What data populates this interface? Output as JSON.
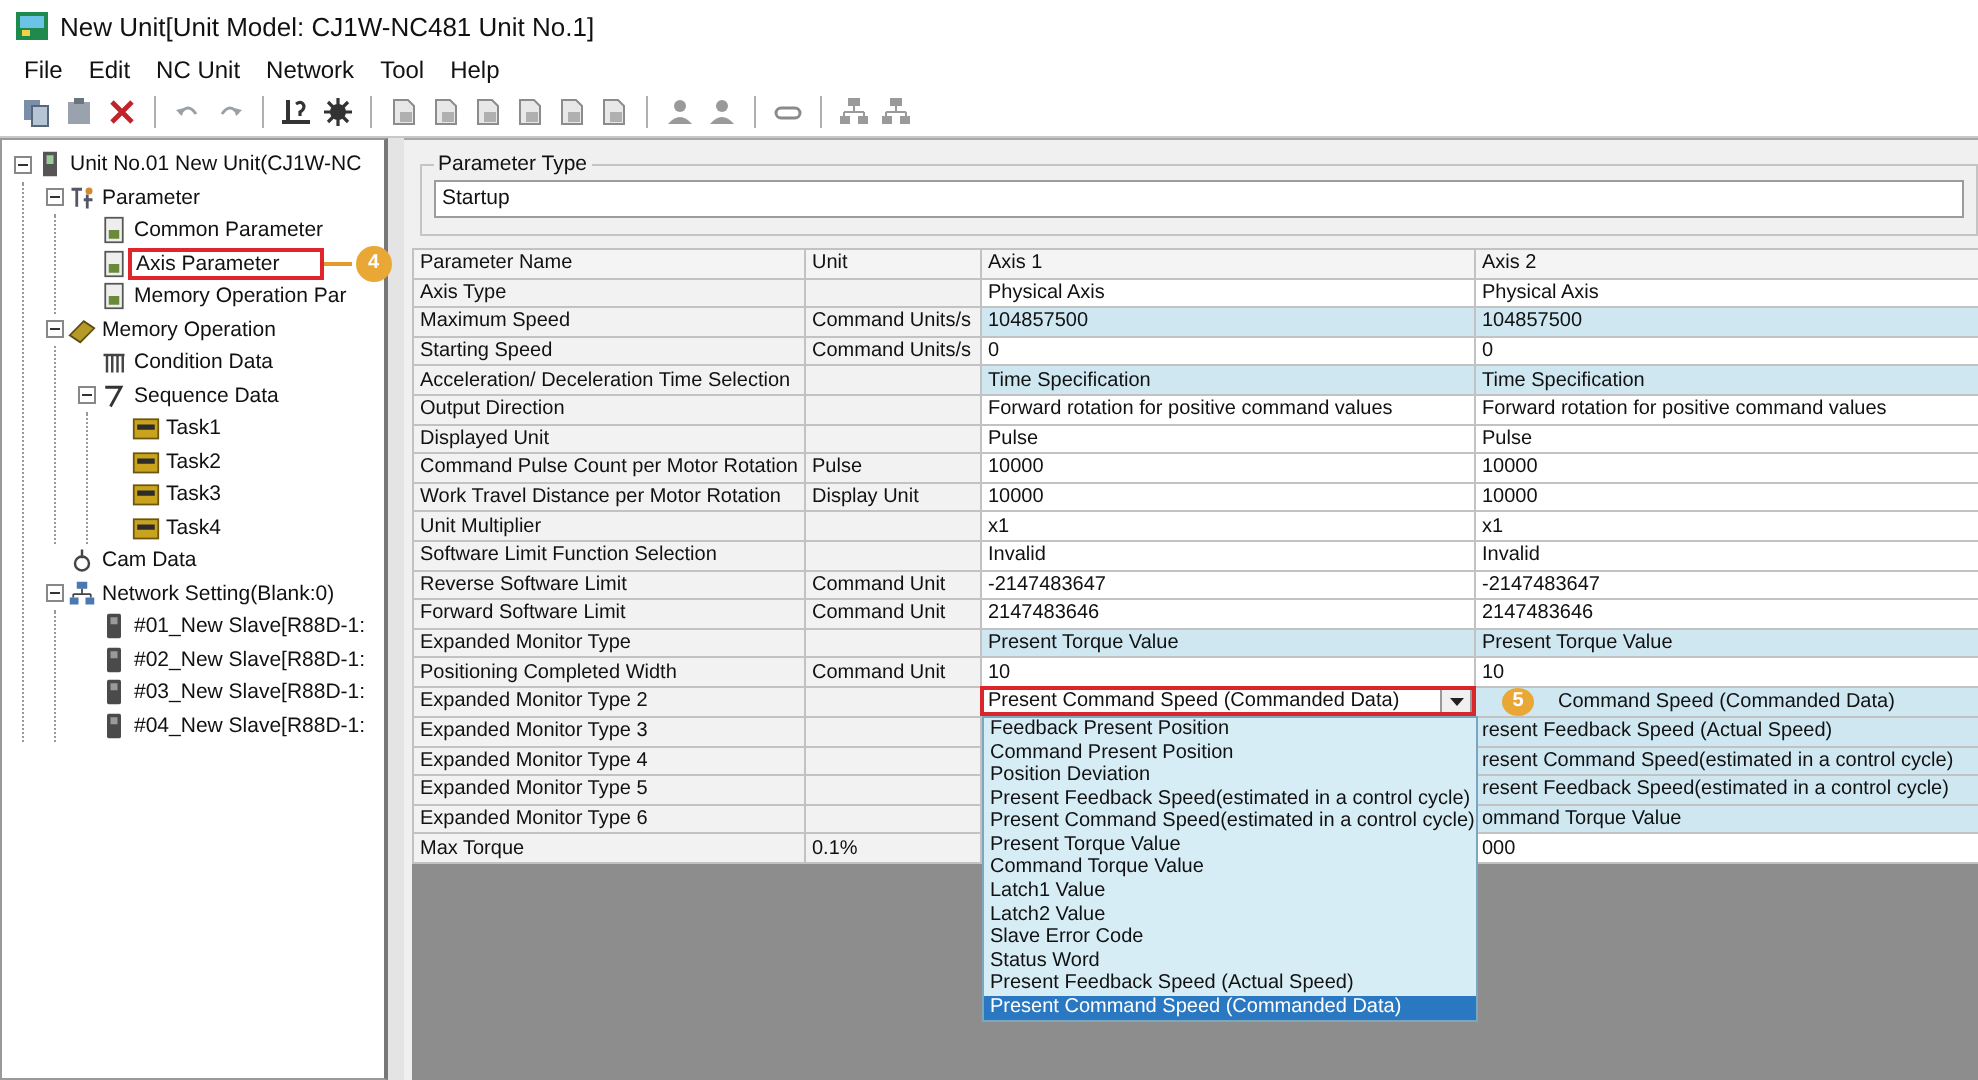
{
  "window": {
    "title": "New Unit[Unit Model: CJ1W-NC481 Unit No.1]"
  },
  "menu": [
    "File",
    "Edit",
    "NC Unit",
    "Network",
    "Tool",
    "Help"
  ],
  "toolbar": [
    {
      "kind": "copy"
    },
    {
      "kind": "clipboard"
    },
    {
      "kind": "delete"
    },
    {
      "kind": "sep"
    },
    {
      "kind": "undo"
    },
    {
      "kind": "redo"
    },
    {
      "kind": "sep"
    },
    {
      "kind": "help"
    },
    {
      "kind": "gear"
    },
    {
      "kind": "sep"
    },
    {
      "kind": "document"
    },
    {
      "kind": "document"
    },
    {
      "kind": "document"
    },
    {
      "kind": "document"
    },
    {
      "kind": "document"
    },
    {
      "kind": "document"
    },
    {
      "kind": "sep"
    },
    {
      "kind": "person"
    },
    {
      "kind": "person"
    },
    {
      "kind": "sep"
    },
    {
      "kind": "link"
    },
    {
      "kind": "sep"
    },
    {
      "kind": "network"
    },
    {
      "kind": "network"
    }
  ],
  "tree": {
    "label": "Unit No.01 New Unit(CJ1W-NC",
    "kind": "unit",
    "expanded": true,
    "children": [
      {
        "label": "Parameter",
        "kind": "parameter",
        "expanded": true,
        "children": [
          {
            "label": "Common Parameter",
            "kind": "document"
          },
          {
            "label": "Axis Parameter",
            "kind": "document",
            "marked": true,
            "callout": "4"
          },
          {
            "label": "Memory Operation Par",
            "kind": "document"
          }
        ]
      },
      {
        "label": "Memory Operation",
        "kind": "memory",
        "expanded": true,
        "children": [
          {
            "label": "Condition Data",
            "kind": "table"
          },
          {
            "label": "Sequence Data",
            "kind": "sequence",
            "expanded": true,
            "children": [
              {
                "label": "Task1",
                "kind": "task"
              },
              {
                "label": "Task2",
                "kind": "task"
              },
              {
                "label": "Task3",
                "kind": "task"
              },
              {
                "label": "Task4",
                "kind": "task"
              }
            ]
          }
        ]
      },
      {
        "label": "Cam Data",
        "kind": "cam"
      },
      {
        "label": "Network Setting(Blank:0)",
        "kind": "network",
        "expanded": true,
        "children": [
          {
            "label": "#01_New Slave[R88D-1:",
            "kind": "device"
          },
          {
            "label": "#02_New Slave[R88D-1:",
            "kind": "device"
          },
          {
            "label": "#03_New Slave[R88D-1:",
            "kind": "device"
          },
          {
            "label": "#04_New Slave[R88D-1:",
            "kind": "device"
          }
        ]
      }
    ]
  },
  "parameter_type": {
    "label": "Parameter Type",
    "value": "Startup"
  },
  "table": {
    "columns": [
      "Parameter Name",
      "Unit",
      "Axis 1",
      "Axis 2"
    ],
    "rows": [
      {
        "name": "Axis Type",
        "axis_1": "Physical Axis",
        "axis_2": "Physical Axis",
        "highlighted": false
      },
      {
        "name": "Maximum Speed",
        "unit": "Command Units/s",
        "axis_1": "104857500",
        "axis_2": "104857500",
        "highlighted": true
      },
      {
        "name": "Starting Speed",
        "unit": "Command Units/s",
        "axis_1": "0",
        "axis_2": "0",
        "highlighted": false
      },
      {
        "name": "Acceleration/ Deceleration Time Selection",
        "axis_1": "Time Specification",
        "axis_2": "Time Specification",
        "highlighted": true
      },
      {
        "name": "Output Direction",
        "axis_1": "Forward rotation for positive command values",
        "axis_2": "Forward rotation for positive command values",
        "highlighted": false
      },
      {
        "name": "Displayed Unit",
        "axis_1": "Pulse",
        "axis_2": "Pulse",
        "highlighted": false
      },
      {
        "name": "Command Pulse Count per Motor Rotation",
        "unit": "Pulse",
        "axis_1": "10000",
        "axis_2": "10000",
        "highlighted": false
      },
      {
        "name": "Work Travel Distance per Motor Rotation",
        "unit": "Display Unit",
        "axis_1": "10000",
        "axis_2": "10000",
        "highlighted": false
      },
      {
        "name": "Unit Multiplier",
        "axis_1": "x1",
        "axis_2": "x1",
        "highlighted": false
      },
      {
        "name": "Software Limit Function Selection",
        "axis_1": "Invalid",
        "axis_2": "Invalid",
        "highlighted": false
      },
      {
        "name": "Reverse Software Limit",
        "unit": "Command Unit",
        "axis_1": "-2147483647",
        "axis_2": "-2147483647",
        "highlighted": false
      },
      {
        "name": "Forward Software Limit",
        "unit": "Command Unit",
        "axis_1": "2147483646",
        "axis_2": "2147483646",
        "highlighted": false
      },
      {
        "name": "Expanded Monitor Type",
        "axis_1": "Present Torque Value",
        "axis_2": "Present Torque Value",
        "highlighted": true
      },
      {
        "name": "Positioning Completed Width",
        "unit": "Command Unit",
        "axis_1": "10",
        "axis_2": "10",
        "highlighted": false
      },
      {
        "name": "Expanded Monitor Type 2",
        "axis_2": "Command Speed (Commanded Data)",
        "highlighted": true,
        "combo": {
          "value": "Present Command Speed (Commanded Data)",
          "marked": true,
          "callout": "5",
          "open": true,
          "options": [
            {
              "label": "Feedback Present Position",
              "selected": false
            },
            {
              "label": "Command Present Position",
              "selected": false
            },
            {
              "label": "Position Deviation",
              "selected": false
            },
            {
              "label": "Present Feedback Speed(estimated in a control cycle)",
              "selected": false
            },
            {
              "label": "Present Command Speed(estimated in a control cycle)",
              "selected": false
            },
            {
              "label": "Present Torque Value",
              "selected": false
            },
            {
              "label": "Command Torque Value",
              "selected": false
            },
            {
              "label": "Latch1 Value",
              "selected": false
            },
            {
              "label": "Latch2 Value",
              "selected": false
            },
            {
              "label": "Slave Error Code",
              "selected": false
            },
            {
              "label": "Status Word",
              "selected": false
            },
            {
              "label": "Present Feedback Speed (Actual Speed)",
              "selected": false
            },
            {
              "label": "Present Command Speed (Commanded Data)",
              "selected": true
            }
          ]
        }
      },
      {
        "name": "Expanded Monitor Type 3",
        "axis_2": "resent Feedback Speed (Actual Speed)",
        "highlighted": true
      },
      {
        "name": "Expanded Monitor Type 4",
        "axis_2": "resent Command Speed(estimated in a control cycle)",
        "highlighted": true
      },
      {
        "name": "Expanded Monitor Type 5",
        "axis_2": "resent Feedback Speed(estimated in a control cycle)",
        "highlighted": true
      },
      {
        "name": "Expanded Monitor Type 6",
        "axis_2": "ommand Torque Value",
        "highlighted": true
      },
      {
        "name": "Max Torque",
        "unit": "0.1%",
        "axis_2": "000",
        "highlighted": false
      }
    ]
  }
}
